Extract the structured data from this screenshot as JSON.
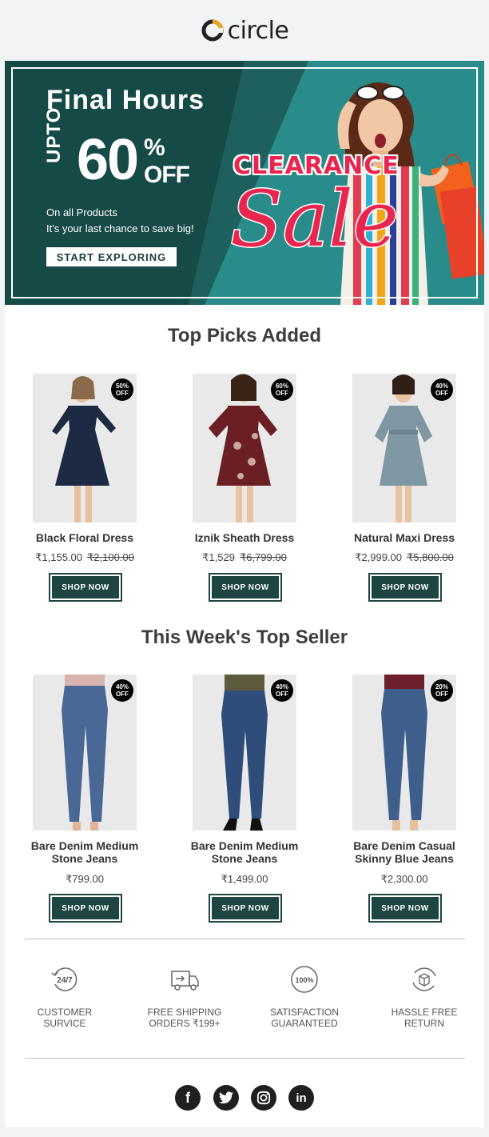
{
  "brand": {
    "name": "circle"
  },
  "hero": {
    "title": "Final Hours",
    "upto": "UPTO",
    "discount": "60",
    "percent": "%",
    "off": "OFF",
    "line1": "On all Products",
    "line2": "It's your last chance to save big!",
    "cta": "START EXPLORING",
    "clearance": "CLEARANCE",
    "sale": "Sale"
  },
  "top_picks": {
    "title": "Top Picks Added",
    "products": [
      {
        "name": "Black Floral Dress",
        "price": "₹1,155.00",
        "old_price": "₹2,100.00",
        "badge_pct": "50%",
        "badge_off": "OFF",
        "cta": "SHOP NOW",
        "dress_color": "#1c2a44"
      },
      {
        "name": "Iznik Sheath Dress",
        "price": "₹1,529",
        "old_price": "₹6,799.00",
        "badge_pct": "60%",
        "badge_off": "OFF",
        "cta": "SHOP NOW",
        "dress_color": "#6b1f24"
      },
      {
        "name": "Natural Maxi Dress",
        "price": "₹2,999.00",
        "old_price": "₹5,800.00",
        "badge_pct": "40%",
        "badge_off": "OFF",
        "cta": "SHOP NOW",
        "dress_color": "#7f97a3"
      }
    ]
  },
  "top_seller": {
    "title": "This Week's Top Seller",
    "products": [
      {
        "name_line1": "Bare Denim Medium",
        "name_line2": "Stone Jeans",
        "price": "₹799.00",
        "badge_pct": "40%",
        "badge_off": "OFF",
        "cta": "SHOP NOW",
        "top_color": "#d9b3ad"
      },
      {
        "name_line1": "Bare Denim Medium",
        "name_line2": "Stone Jeans",
        "price": "₹1,499.00",
        "badge_pct": "40%",
        "badge_off": "OFF",
        "cta": "SHOP NOW",
        "top_color": "#5d5a3e"
      },
      {
        "name_line1": "Bare Denim Casual",
        "name_line2": "Skinny Blue Jeans",
        "price": "₹2,300.00",
        "badge_pct": "20%",
        "badge_off": "OFF",
        "cta": "SHOP NOW",
        "top_color": "#6d1f2c"
      }
    ]
  },
  "features": [
    {
      "icon": "24-7-icon",
      "line1": "CUSTOMER",
      "line2": "SURVICE",
      "badge": "24/7"
    },
    {
      "icon": "truck-icon",
      "line1": "FREE SHIPPING",
      "line2": "ORDERS ₹199+"
    },
    {
      "icon": "satisfaction-icon",
      "line1": "SATISFACTION",
      "line2": "GUARANTEED",
      "badge": "100%"
    },
    {
      "icon": "return-box-icon",
      "line1": "HASSLE FREE",
      "line2": "RETURN"
    }
  ],
  "social": [
    {
      "icon": "facebook-icon",
      "glyph": "f"
    },
    {
      "icon": "twitter-icon"
    },
    {
      "icon": "instagram-icon"
    },
    {
      "icon": "linkedin-icon",
      "glyph": "in"
    }
  ],
  "colors": {
    "brand_dark_teal": "#1d4541",
    "hero_bg": "#154a47",
    "hero_accent": "#2a8c8a",
    "sale_red": "#e8264f",
    "logo_orange": "#f2a516"
  }
}
